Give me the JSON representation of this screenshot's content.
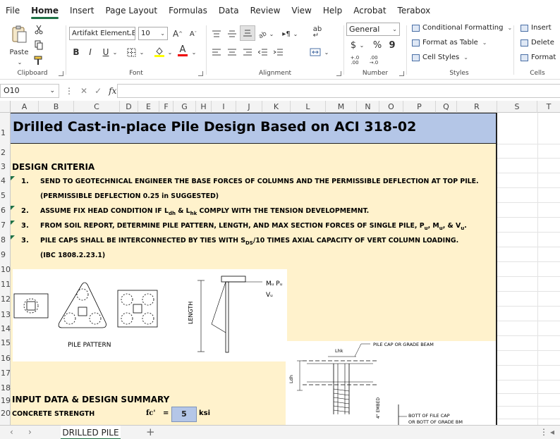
{
  "menu": {
    "items": [
      "File",
      "Home",
      "Insert",
      "Page Layout",
      "Formulas",
      "Data",
      "Review",
      "View",
      "Help",
      "Acrobat",
      "Terabox"
    ],
    "active": "Home"
  },
  "ribbon": {
    "clipboard": {
      "paste_label": "Paste",
      "group_label": "Clipboard"
    },
    "font": {
      "font_name": "Artifakt Element Bl",
      "font_size": "10",
      "grow": "A",
      "shrink": "A",
      "bold": "B",
      "italic": "I",
      "underline": "U",
      "font_color_letter": "A",
      "group_label": "Font"
    },
    "alignment": {
      "group_label": "Alignment"
    },
    "number": {
      "format": "General",
      "currency": "$",
      "percent": "%",
      "comma": "9",
      "inc_decimal": "+.0 .00",
      "dec_decimal": ".00 →.0",
      "group_label": "Number"
    },
    "styles": {
      "conditional": "Conditional Formatting",
      "format_table": "Format as Table",
      "cell_styles": "Cell Styles",
      "group_label": "Styles"
    },
    "cells": {
      "insert": "Insert",
      "delete": "Delete",
      "format": "Format",
      "group_label": "Cells"
    }
  },
  "formula_bar": {
    "name_box": "O10",
    "fx": "fx",
    "cancel": "✕",
    "enter": "✓",
    "dots": "⋮",
    "content": ""
  },
  "columns": [
    "A",
    "B",
    "C",
    "D",
    "E",
    "F",
    "G",
    "H",
    "I",
    "J",
    "K",
    "L",
    "M",
    "N",
    "O",
    "P",
    "Q",
    "R",
    "S",
    "T"
  ],
  "rows": [
    "1",
    "2",
    "3",
    "4",
    "5",
    "6",
    "7",
    "8",
    "9",
    "10",
    "11",
    "12",
    "13",
    "14",
    "15",
    "16",
    "17",
    "18",
    "19",
    "20"
  ],
  "sheet": {
    "title": "Drilled Cast-in-place Pile Design Based on ACI 318-02",
    "design_criteria_header": "DESIGN CRITERIA",
    "criteria": [
      {
        "num": "1.",
        "text": "SEND TO GEOTECHNICAL ENGINEER THE BASE FORCES OF COLUMNS AND THE PERMISSIBLE DEFLECTION AT TOP PILE."
      },
      {
        "num": "",
        "text": "(PERMISSIBLE DEFLECTION 0.25 in SUGGESTED)"
      },
      {
        "num": "2.",
        "text_a": "ASSUME FIX HEAD CONDITION IF L",
        "sub_a": "dh",
        "text_b": " & L",
        "sub_b": "hk",
        "text_c": " COMPLY WITH THE TENSION DEVELOPMEMNT."
      },
      {
        "num": "3.",
        "text_a": "FROM SOIL REPORT, DETERMINE PILE PATTERN, LENGTH, AND MAX SECTION FORCES OF SINGLE PILE, P",
        "sub_a": "u",
        "text_b": ", M",
        "sub_b": "u",
        "text_c": ", & V",
        "sub_c": "u",
        "text_d": "."
      },
      {
        "num": "3.",
        "text_a": "PILE CAPS SHALL BE INTERCONNECTED BY TIES WITH S",
        "sub_a": "DS",
        "text_b": "/10 TIMES AXIAL CAPACITY OF VERT COLUMN LOADING."
      },
      {
        "num": "",
        "text": "(IBC 1808.2.23.1)"
      }
    ],
    "figure1": {
      "caption": "PILE PATTERN",
      "length_label": "LENGTH",
      "mu_pu": "Mᵤ Pᵤ",
      "vu": "Vᵤ"
    },
    "figure2": {
      "pile_cap_label": "PILE CAP OR GRADE BEAM",
      "lhk": "Lhk",
      "ldh": "Ldh",
      "embed": "4\" EMBED",
      "bott_label": "BOTT OF FILE CAP",
      "bott_label2": "OR BOTT OF GRADE BM"
    },
    "input_header": "INPUT DATA & DESIGN SUMMARY",
    "concrete": {
      "label": "CONCRETE STRENGTH",
      "symbol": "fc'",
      "eq": "=",
      "value": "5",
      "unit": "ksi"
    }
  },
  "tabs": {
    "active": "DRILLED PILE",
    "prev": "‹",
    "next": "›",
    "add": "+"
  }
}
